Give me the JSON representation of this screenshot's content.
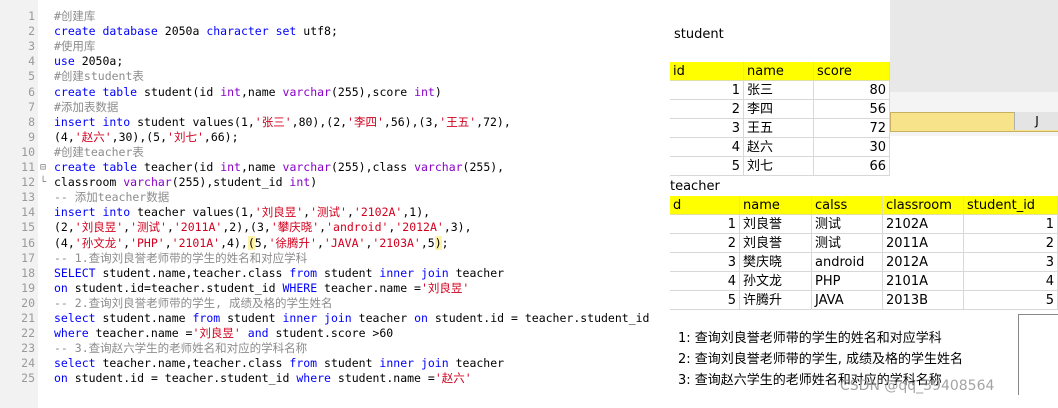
{
  "editor": {
    "lines": [
      {
        "n": "1",
        "tokens": [
          [
            "cm",
            "#创建库"
          ]
        ]
      },
      {
        "n": "2",
        "tokens": [
          [
            "kw",
            "create database "
          ],
          [
            "nm",
            "2050a "
          ],
          [
            "kw",
            "character set "
          ],
          [
            "nm",
            "utf8;"
          ]
        ]
      },
      {
        "n": "3",
        "tokens": [
          [
            "cm",
            "#使用库"
          ]
        ]
      },
      {
        "n": "4",
        "tokens": [
          [
            "kw",
            "use "
          ],
          [
            "nm",
            "2050a;"
          ]
        ]
      },
      {
        "n": "5",
        "tokens": [
          [
            "cm",
            "#创建student表"
          ]
        ]
      },
      {
        "n": "6",
        "tokens": [
          [
            "kw",
            "create table "
          ],
          [
            "nm",
            "student(id "
          ],
          [
            "ty",
            "int"
          ],
          [
            "nm",
            ",name "
          ],
          [
            "ty",
            "varchar"
          ],
          [
            "nm",
            "(255),score "
          ],
          [
            "ty",
            "int"
          ],
          [
            "nm",
            ")"
          ]
        ]
      },
      {
        "n": "7",
        "tokens": [
          [
            "cm",
            "#添加表数据"
          ]
        ]
      },
      {
        "n": "8",
        "tokens": [
          [
            "kw",
            "insert into "
          ],
          [
            "nm",
            "student values(1,"
          ],
          [
            "st",
            "'张三'"
          ],
          [
            "nm",
            ",80),(2,"
          ],
          [
            "st",
            "'李四'"
          ],
          [
            "nm",
            ",56),(3,"
          ],
          [
            "st",
            "'王五'"
          ],
          [
            "nm",
            ",72),"
          ]
        ]
      },
      {
        "n": "9",
        "tokens": [
          [
            "nm",
            "(4,"
          ],
          [
            "st",
            "'赵六'"
          ],
          [
            "nm",
            ",30),(5,"
          ],
          [
            "st",
            "'刘七'"
          ],
          [
            "nm",
            ",66);"
          ]
        ]
      },
      {
        "n": "10",
        "tokens": [
          [
            "cm",
            "#创建teacher表"
          ]
        ]
      },
      {
        "n": "11",
        "fold": "⊟",
        "tokens": [
          [
            "kw",
            "create table "
          ],
          [
            "nm",
            "teacher(id "
          ],
          [
            "ty",
            "int"
          ],
          [
            "nm",
            ",name "
          ],
          [
            "ty",
            "varchar"
          ],
          [
            "nm",
            "(255),class "
          ],
          [
            "ty",
            "varchar"
          ],
          [
            "nm",
            "(255),"
          ]
        ]
      },
      {
        "n": "12",
        "fold": "└",
        "tokens": [
          [
            "nm",
            "classroom "
          ],
          [
            "ty",
            "varchar"
          ],
          [
            "nm",
            "(255),student_id "
          ],
          [
            "ty",
            "int"
          ],
          [
            "nm",
            ")"
          ]
        ]
      },
      {
        "n": "13",
        "tokens": [
          [
            "cm",
            "-- 添加teacher数据"
          ]
        ]
      },
      {
        "n": "14",
        "tokens": [
          [
            "kw",
            "insert into "
          ],
          [
            "nm",
            "teacher values(1,"
          ],
          [
            "st",
            "'刘良昱'"
          ],
          [
            "nm",
            ","
          ],
          [
            "st",
            "'测试'"
          ],
          [
            "nm",
            ","
          ],
          [
            "st",
            "'2102A'"
          ],
          [
            "nm",
            ",1),"
          ]
        ]
      },
      {
        "n": "15",
        "tokens": [
          [
            "nm",
            "(2,"
          ],
          [
            "st",
            "'刘良昱'"
          ],
          [
            "nm",
            ","
          ],
          [
            "st",
            "'测试'"
          ],
          [
            "nm",
            ","
          ],
          [
            "st",
            "'2011A'"
          ],
          [
            "nm",
            ",2),(3,"
          ],
          [
            "st",
            "'攀庆晓'"
          ],
          [
            "nm",
            ","
          ],
          [
            "st",
            "'android'"
          ],
          [
            "nm",
            ","
          ],
          [
            "st",
            "'2012A'"
          ],
          [
            "nm",
            ",3),"
          ]
        ]
      },
      {
        "n": "16",
        "tokens": [
          [
            "nm",
            "(4,"
          ],
          [
            "st",
            "'孙文龙'"
          ],
          [
            "nm",
            ","
          ],
          [
            "st",
            "'PHP'"
          ],
          [
            "nm",
            ","
          ],
          [
            "st",
            "'2101A'"
          ],
          [
            "nm",
            ",4),"
          ],
          [
            "hl",
            "("
          ],
          [
            "nm",
            "5,"
          ],
          [
            "st",
            "'徐腾升'"
          ],
          [
            "nm",
            ","
          ],
          [
            "st",
            "'JAVA'"
          ],
          [
            "nm",
            ","
          ],
          [
            "st",
            "'2103A'"
          ],
          [
            "nm",
            ",5"
          ],
          [
            "hl",
            ")"
          ],
          [
            "nm",
            ";"
          ]
        ]
      },
      {
        "n": "17",
        "tokens": [
          [
            "cm",
            "-- 1.查询刘良誉老师带的学生的姓名和对应学科"
          ]
        ]
      },
      {
        "n": "18",
        "tokens": [
          [
            "kw",
            "SELECT "
          ],
          [
            "nm",
            "student.name,teacher.class "
          ],
          [
            "kw",
            "from "
          ],
          [
            "nm",
            "student "
          ],
          [
            "kw",
            "inner join "
          ],
          [
            "nm",
            "teacher"
          ]
        ]
      },
      {
        "n": "19",
        "tokens": [
          [
            "kw",
            "on "
          ],
          [
            "nm",
            "student.id=teacher.student_id "
          ],
          [
            "kw",
            "WHERE "
          ],
          [
            "nm",
            "teacher.name ="
          ],
          [
            "st",
            "'刘良昱'"
          ]
        ]
      },
      {
        "n": "20",
        "tokens": [
          [
            "cm",
            "-- 2.查询刘良誉老师带的学生, 成绩及格的学生姓名"
          ]
        ]
      },
      {
        "n": "21",
        "tokens": [
          [
            "kw",
            "select "
          ],
          [
            "nm",
            "student.name "
          ],
          [
            "kw",
            "from "
          ],
          [
            "nm",
            "student "
          ],
          [
            "kw",
            "inner join "
          ],
          [
            "nm",
            "teacher "
          ],
          [
            "kw",
            "on "
          ],
          [
            "nm",
            "student.id = teacher.student_id"
          ]
        ]
      },
      {
        "n": "22",
        "tokens": [
          [
            "kw",
            "where "
          ],
          [
            "nm",
            "teacher.name ="
          ],
          [
            "st",
            "'刘良昱'"
          ],
          [
            "nm",
            " "
          ],
          [
            "kw",
            "and "
          ],
          [
            "nm",
            "student.score >60"
          ]
        ]
      },
      {
        "n": "23",
        "tokens": [
          [
            "cm",
            "-- 3.查询赵六学生的老师姓名和对应的学科名称"
          ]
        ]
      },
      {
        "n": "24",
        "tokens": [
          [
            "kw",
            "select "
          ],
          [
            "nm",
            "teacher.name,teacher.class "
          ],
          [
            "kw",
            "from "
          ],
          [
            "nm",
            "student "
          ],
          [
            "kw",
            "inner join "
          ],
          [
            "nm",
            "teacher"
          ]
        ]
      },
      {
        "n": "25",
        "tokens": [
          [
            "kw",
            "on "
          ],
          [
            "nm",
            "student.id = teacher.student_id "
          ],
          [
            "kw",
            "where "
          ],
          [
            "nm",
            "student.name ="
          ],
          [
            "st",
            "'赵六'"
          ]
        ]
      }
    ]
  },
  "student_sheet": {
    "title": "student",
    "columns": [
      "id",
      "name",
      "score"
    ],
    "rows": [
      [
        "1",
        "张三",
        "80"
      ],
      [
        "2",
        "李四",
        "56"
      ],
      [
        "3",
        "王五",
        "72"
      ],
      [
        "4",
        "赵六",
        "30"
      ],
      [
        "5",
        "刘七",
        "66"
      ]
    ]
  },
  "teacher_sheet": {
    "title": "teacher",
    "columns": [
      "d",
      "name",
      "calss",
      "classroom",
      "student_id"
    ],
    "rows": [
      [
        "1",
        "刘良誉",
        "测试",
        "2102A",
        "1"
      ],
      [
        "2",
        "刘良誉",
        "测试",
        "2011A",
        "2"
      ],
      [
        "3",
        "樊庆晓",
        "android",
        "2012A",
        "3"
      ],
      [
        "4",
        "孙文龙",
        "PHP",
        "2101A",
        "4"
      ],
      [
        "5",
        "许腾升",
        "JAVA",
        "2013B",
        "5"
      ]
    ]
  },
  "grid_fragment": {
    "col_label": "J"
  },
  "notes": [
    "1:  查询刘良誉老师带的学生的姓名和对应学科",
    "2:  查询刘良誉老师带的学生, 成绩及格的学生姓名",
    "3:  查询赵六学生的老师姓名和对应的学科名称"
  ],
  "watermark": "CSDN @qq_39408564",
  "colors": {
    "header_yellow": "#ffff00",
    "keyword": "#0000ff",
    "string": "#d2001e",
    "comment": "#8c8c8c",
    "type": "#8a00c8"
  }
}
